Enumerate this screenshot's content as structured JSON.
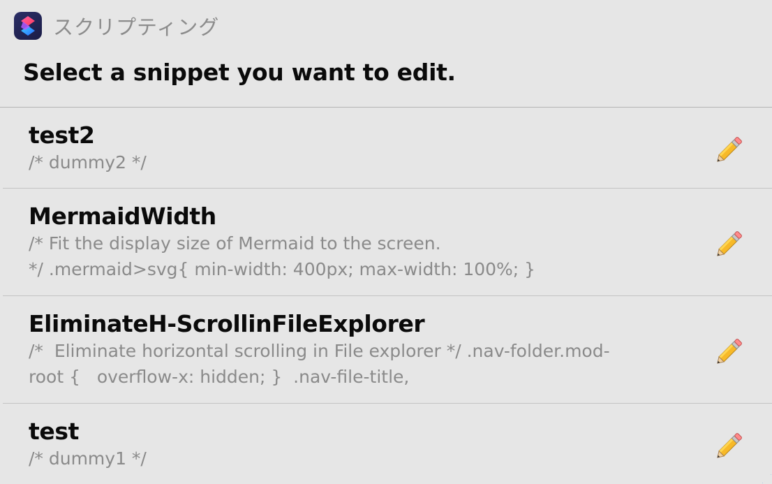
{
  "app": {
    "name": "スクリプティング",
    "icon": "shortcuts-app-icon"
  },
  "prompt": "Select a snippet you want to edit.",
  "snippets": [
    {
      "title": "test2",
      "subtitle": "/* dummy2 */",
      "action_icon": "pencil-icon"
    },
    {
      "title": "MermaidWidth",
      "subtitle": "/* Fit the display size of Mermaid to the screen.\n*/ .mermaid>svg{ min-width: 400px; max-width: 100%; }",
      "action_icon": "pencil-icon"
    },
    {
      "title": "EliminateH-ScrollinFileExplorer",
      "subtitle": "/*  Eliminate horizontal scrolling in File explorer */ .nav-folder.mod-\nroot {   overflow-x: hidden; }  .nav-file-title,",
      "action_icon": "pencil-icon"
    },
    {
      "title": "test",
      "subtitle": "/* dummy1 */",
      "action_icon": "pencil-icon"
    }
  ],
  "colors": {
    "background": "#e6e6e6",
    "title": "#0a0a0a",
    "subtitle": "#8a8a8a",
    "app_name": "#8c8c8c"
  }
}
